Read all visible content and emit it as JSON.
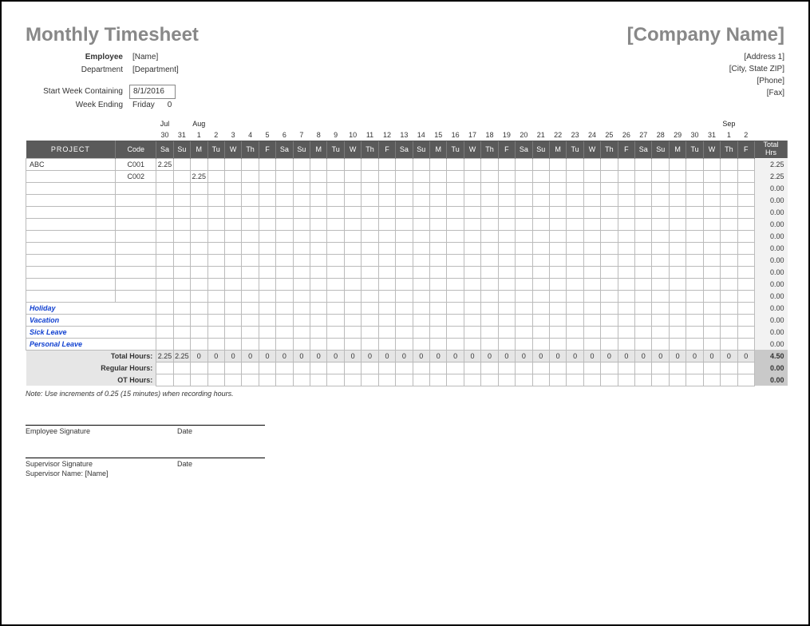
{
  "title": "Monthly Timesheet",
  "company": "[Company Name]",
  "address": [
    "[Address 1]",
    "[City, State ZIP]",
    "[Phone]",
    "[Fax]"
  ],
  "meta": {
    "employee_label": "Employee",
    "employee_value": "[Name]",
    "department_label": "Department",
    "department_value": "[Department]",
    "start_label": "Start Week Containing",
    "start_value": "8/1/2016",
    "week_ending_label": "Week Ending",
    "week_ending_value": "Friday",
    "week_ending_extra": "0"
  },
  "months": {
    "jul_label": "Jul",
    "aug_label": "Aug",
    "sep_label": "Sep"
  },
  "dates": [
    "30",
    "31",
    "1",
    "2",
    "3",
    "4",
    "5",
    "6",
    "7",
    "8",
    "9",
    "10",
    "11",
    "12",
    "13",
    "14",
    "15",
    "16",
    "17",
    "18",
    "19",
    "20",
    "21",
    "22",
    "23",
    "24",
    "25",
    "26",
    "27",
    "28",
    "29",
    "30",
    "31",
    "1",
    "2"
  ],
  "dow": [
    "Sa",
    "Su",
    "M",
    "Tu",
    "W",
    "Th",
    "F",
    "Sa",
    "Su",
    "M",
    "Tu",
    "W",
    "Th",
    "F",
    "Sa",
    "Su",
    "M",
    "Tu",
    "W",
    "Th",
    "F",
    "Sa",
    "Su",
    "M",
    "Tu",
    "W",
    "Th",
    "F",
    "Sa",
    "Su",
    "M",
    "Tu",
    "W",
    "Th",
    "F"
  ],
  "headers": {
    "project": "PROJECT",
    "code": "Code",
    "total_hrs": "Total Hrs"
  },
  "rows": [
    {
      "project": "ABC",
      "code": "C001",
      "cells": [
        "2.25",
        "",
        "",
        "",
        "",
        "",
        "",
        "",
        "",
        "",
        "",
        "",
        "",
        "",
        "",
        "",
        "",
        "",
        "",
        "",
        "",
        "",
        "",
        "",
        "",
        "",
        "",
        "",
        "",
        "",
        "",
        "",
        "",
        "",
        ""
      ],
      "total": "2.25"
    },
    {
      "project": "",
      "code": "C002",
      "cells": [
        "",
        "",
        "2.25",
        "",
        "",
        "",
        "",
        "",
        "",
        "",
        "",
        "",
        "",
        "",
        "",
        "",
        "",
        "",
        "",
        "",
        "",
        "",
        "",
        "",
        "",
        "",
        "",
        "",
        "",
        "",
        "",
        "",
        "",
        "",
        ""
      ],
      "total": "2.25"
    },
    {
      "project": "",
      "code": "",
      "cells": [
        "",
        "",
        "",
        "",
        "",
        "",
        "",
        "",
        "",
        "",
        "",
        "",
        "",
        "",
        "",
        "",
        "",
        "",
        "",
        "",
        "",
        "",
        "",
        "",
        "",
        "",
        "",
        "",
        "",
        "",
        "",
        "",
        "",
        "",
        ""
      ],
      "total": "0.00"
    },
    {
      "project": "",
      "code": "",
      "cells": [
        "",
        "",
        "",
        "",
        "",
        "",
        "",
        "",
        "",
        "",
        "",
        "",
        "",
        "",
        "",
        "",
        "",
        "",
        "",
        "",
        "",
        "",
        "",
        "",
        "",
        "",
        "",
        "",
        "",
        "",
        "",
        "",
        "",
        "",
        ""
      ],
      "total": "0.00"
    },
    {
      "project": "",
      "code": "",
      "cells": [
        "",
        "",
        "",
        "",
        "",
        "",
        "",
        "",
        "",
        "",
        "",
        "",
        "",
        "",
        "",
        "",
        "",
        "",
        "",
        "",
        "",
        "",
        "",
        "",
        "",
        "",
        "",
        "",
        "",
        "",
        "",
        "",
        "",
        "",
        ""
      ],
      "total": "0.00"
    },
    {
      "project": "",
      "code": "",
      "cells": [
        "",
        "",
        "",
        "",
        "",
        "",
        "",
        "",
        "",
        "",
        "",
        "",
        "",
        "",
        "",
        "",
        "",
        "",
        "",
        "",
        "",
        "",
        "",
        "",
        "",
        "",
        "",
        "",
        "",
        "",
        "",
        "",
        "",
        "",
        ""
      ],
      "total": "0.00"
    },
    {
      "project": "",
      "code": "",
      "cells": [
        "",
        "",
        "",
        "",
        "",
        "",
        "",
        "",
        "",
        "",
        "",
        "",
        "",
        "",
        "",
        "",
        "",
        "",
        "",
        "",
        "",
        "",
        "",
        "",
        "",
        "",
        "",
        "",
        "",
        "",
        "",
        "",
        "",
        "",
        ""
      ],
      "total": "0.00"
    },
    {
      "project": "",
      "code": "",
      "cells": [
        "",
        "",
        "",
        "",
        "",
        "",
        "",
        "",
        "",
        "",
        "",
        "",
        "",
        "",
        "",
        "",
        "",
        "",
        "",
        "",
        "",
        "",
        "",
        "",
        "",
        "",
        "",
        "",
        "",
        "",
        "",
        "",
        "",
        "",
        ""
      ],
      "total": "0.00"
    },
    {
      "project": "",
      "code": "",
      "cells": [
        "",
        "",
        "",
        "",
        "",
        "",
        "",
        "",
        "",
        "",
        "",
        "",
        "",
        "",
        "",
        "",
        "",
        "",
        "",
        "",
        "",
        "",
        "",
        "",
        "",
        "",
        "",
        "",
        "",
        "",
        "",
        "",
        "",
        "",
        ""
      ],
      "total": "0.00"
    },
    {
      "project": "",
      "code": "",
      "cells": [
        "",
        "",
        "",
        "",
        "",
        "",
        "",
        "",
        "",
        "",
        "",
        "",
        "",
        "",
        "",
        "",
        "",
        "",
        "",
        "",
        "",
        "",
        "",
        "",
        "",
        "",
        "",
        "",
        "",
        "",
        "",
        "",
        "",
        "",
        ""
      ],
      "total": "0.00"
    },
    {
      "project": "",
      "code": "",
      "cells": [
        "",
        "",
        "",
        "",
        "",
        "",
        "",
        "",
        "",
        "",
        "",
        "",
        "",
        "",
        "",
        "",
        "",
        "",
        "",
        "",
        "",
        "",
        "",
        "",
        "",
        "",
        "",
        "",
        "",
        "",
        "",
        "",
        "",
        "",
        ""
      ],
      "total": "0.00"
    },
    {
      "project": "",
      "code": "",
      "cells": [
        "",
        "",
        "",
        "",
        "",
        "",
        "",
        "",
        "",
        "",
        "",
        "",
        "",
        "",
        "",
        "",
        "",
        "",
        "",
        "",
        "",
        "",
        "",
        "",
        "",
        "",
        "",
        "",
        "",
        "",
        "",
        "",
        "",
        "",
        ""
      ],
      "total": "0.00"
    }
  ],
  "leave_rows": [
    {
      "project": "Holiday",
      "total": "0.00"
    },
    {
      "project": "Vacation",
      "total": "0.00"
    },
    {
      "project": "Sick Leave",
      "total": "0.00"
    },
    {
      "project": "Personal Leave",
      "total": "0.00"
    }
  ],
  "totals": {
    "total_hours_label": "Total Hours:",
    "regular_hours_label": "Regular Hours:",
    "ot_hours_label": "OT Hours:",
    "total_hours": [
      "2.25",
      "2.25",
      "0",
      "0",
      "0",
      "0",
      "0",
      "0",
      "0",
      "0",
      "0",
      "0",
      "0",
      "0",
      "0",
      "0",
      "0",
      "0",
      "0",
      "0",
      "0",
      "0",
      "0",
      "0",
      "0",
      "0",
      "0",
      "0",
      "0",
      "0",
      "0",
      "0",
      "0",
      "0",
      "0"
    ],
    "grand_total": "4.50",
    "regular_grand": "0.00",
    "ot_grand": "0.00"
  },
  "note": "Note: Use increments of 0.25 (15 minutes) when recording hours.",
  "sig": {
    "emp_sig": "Employee Signature",
    "date": "Date",
    "sup_sig": "Supervisor Signature",
    "sup_name_label": "Supervisor Name:",
    "sup_name_value": "[Name]"
  }
}
